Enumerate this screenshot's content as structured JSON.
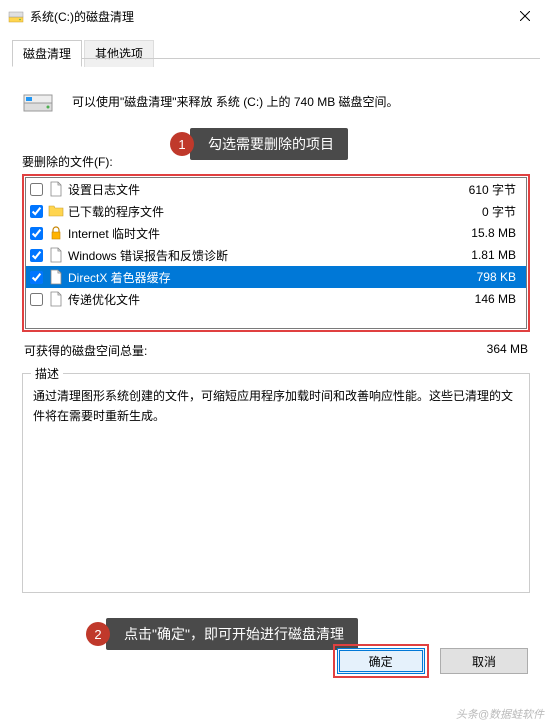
{
  "title": "系统(C:)的磁盘清理",
  "tabs": {
    "active": "磁盘清理",
    "inactive": "其他选项"
  },
  "info_text": "可以使用\"磁盘清理\"来释放 系统 (C:) 上的 740 MB 磁盘空间。",
  "callout1": {
    "num": "1",
    "text": "勾选需要删除的项目"
  },
  "section_label": "要删除的文件(F):",
  "files": [
    {
      "checked": false,
      "icon": "file",
      "label": "设置日志文件",
      "size": "610 字节"
    },
    {
      "checked": true,
      "icon": "folder",
      "label": "已下载的程序文件",
      "size": "0 字节"
    },
    {
      "checked": true,
      "icon": "lock",
      "label": "Internet 临时文件",
      "size": "15.8 MB"
    },
    {
      "checked": true,
      "icon": "file",
      "label": "Windows 错误报告和反馈诊断",
      "size": "1.81 MB"
    },
    {
      "checked": true,
      "icon": "file",
      "label": "DirectX 着色器缓存",
      "size": "798 KB",
      "selected": true
    },
    {
      "checked": false,
      "icon": "file",
      "label": "传递优化文件",
      "size": "146 MB"
    }
  ],
  "total": {
    "label": "可获得的磁盘空间总量:",
    "value": "364 MB"
  },
  "desc": {
    "legend": "描述",
    "text": "通过清理图形系统创建的文件，可缩短应用程序加载时间和改善响应性能。这些已清理的文件将在需要时重新生成。"
  },
  "callout2": {
    "num": "2",
    "text": "点击\"确定\"，即可开始进行磁盘清理"
  },
  "buttons": {
    "ok": "确定",
    "cancel": "取消"
  },
  "watermark": "头条@数据蛙软件"
}
